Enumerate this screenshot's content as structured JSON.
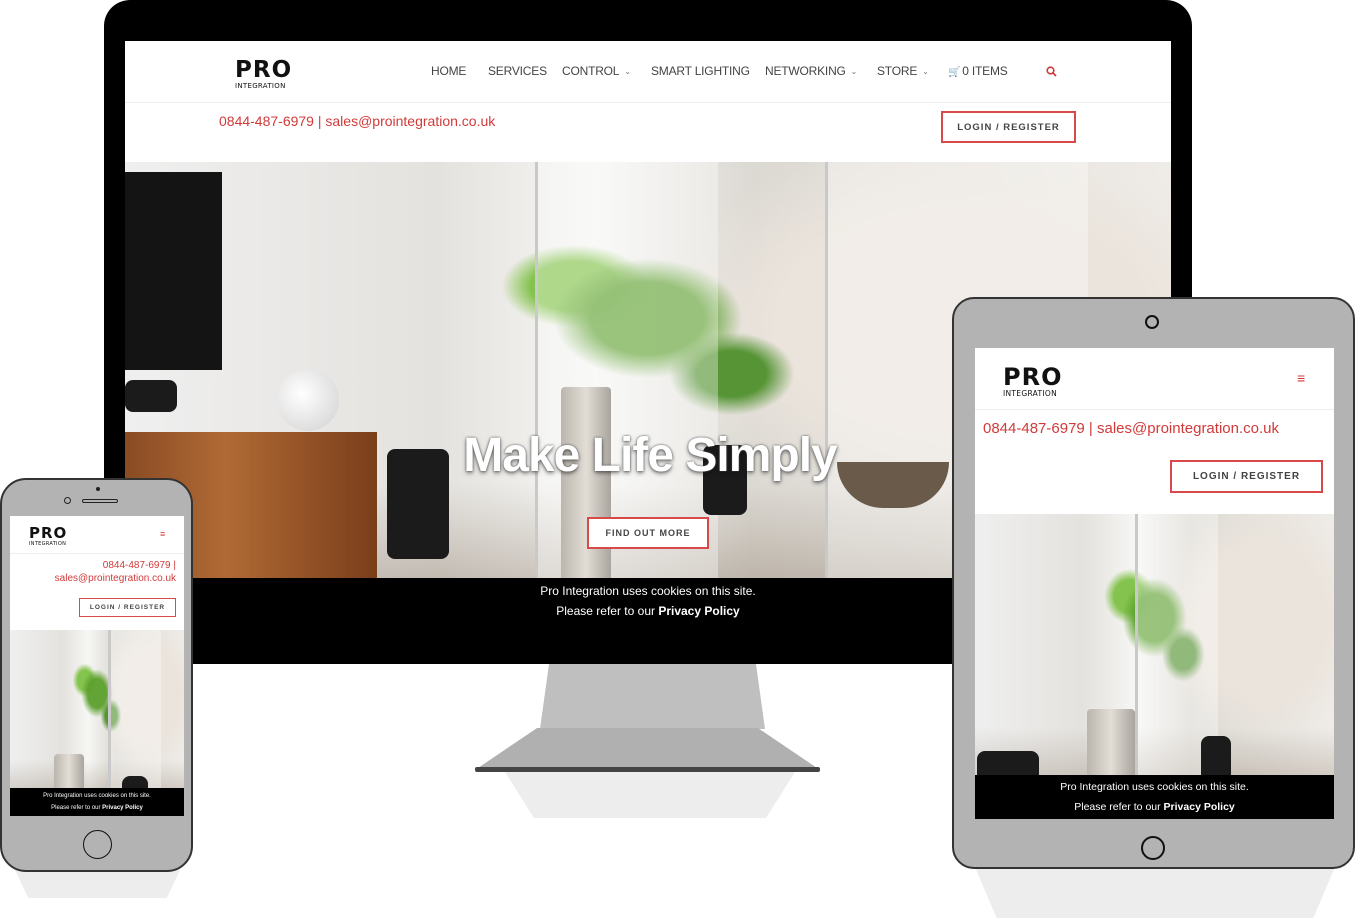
{
  "brand": {
    "logo_main": "PRO",
    "logo_sub": "INTEGRATION"
  },
  "nav": {
    "items": [
      {
        "label": "HOME"
      },
      {
        "label": "SERVICES"
      },
      {
        "label": "CONTROL"
      },
      {
        "label": "SMART LIGHTING"
      },
      {
        "label": "NETWORKING"
      },
      {
        "label": "STORE"
      }
    ],
    "cart_label": "0 ITEMS",
    "search_icon": "search-icon"
  },
  "contact": {
    "line": "0844-487-6979 | sales@prointegration.co.uk",
    "phone_line": "0844-487-6979 |",
    "email": "sales@prointegration.co.uk"
  },
  "login_label": "LOGIN / REGISTER",
  "hero": {
    "title": "Make Life Simply",
    "button": "FIND OUT MORE"
  },
  "cookie": {
    "line1": "Pro Integration uses cookies on this site.",
    "line2_prefix": "Please refer to our",
    "link": "Privacy Policy"
  },
  "menu_icon": "hamburger-menu-icon",
  "colors": {
    "accent": "#d23a3a",
    "bezel": "#000000",
    "device_gray": "#b3b3b3"
  }
}
